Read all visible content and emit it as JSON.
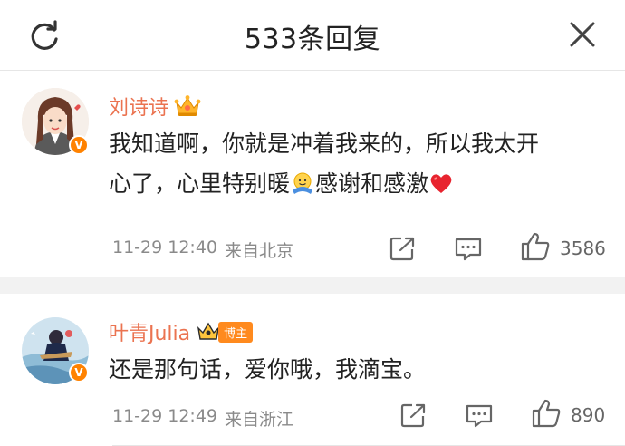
{
  "header": {
    "title": "533条回复"
  },
  "comments": [
    {
      "name": "刘诗诗",
      "text_line1": "我知道啊，你就是冲着我来的，所以我太开",
      "text_line2_a": "心了，心里特别暖",
      "text_line2_b": "感谢和感激",
      "time": "11-29 12:40",
      "source": "来自北京",
      "likes": "3586",
      "verified": "V"
    },
    {
      "name": "叶青Julia",
      "badge": "博主",
      "text": "还是那句话，爱你哦，我滴宝。",
      "time": "11-29 12:49",
      "source": "来自浙江",
      "likes": "890",
      "verified": "V"
    }
  ],
  "colors": {
    "name": "#eb7350",
    "accent": "#ff8200",
    "meta": "#8a8a8a"
  },
  "icons": [
    "refresh-icon",
    "close-icon",
    "repost-icon",
    "comment-icon",
    "like-icon",
    "crown-icon",
    "hug-emoji-icon",
    "heart-emoji-icon"
  ]
}
